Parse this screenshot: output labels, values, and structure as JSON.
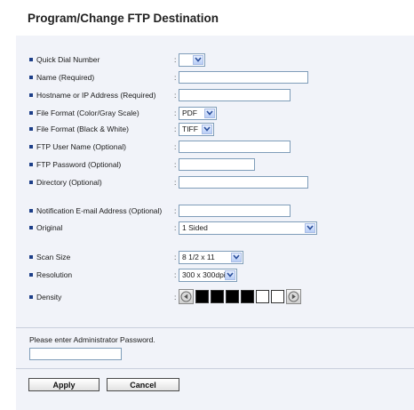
{
  "page": {
    "title": "Program/Change FTP Destination"
  },
  "form": {
    "quick_dial": {
      "label": "Quick Dial Number",
      "value": ""
    },
    "name": {
      "label": "Name (Required)",
      "value": ""
    },
    "hostname": {
      "label": "Hostname or IP Address (Required)",
      "value": ""
    },
    "format_color": {
      "label": "File Format (Color/Gray Scale)",
      "value": "PDF"
    },
    "format_bw": {
      "label": "File Format (Black & White)",
      "value": "TIFF"
    },
    "ftp_user": {
      "label": "FTP User Name (Optional)",
      "value": ""
    },
    "ftp_password": {
      "label": "FTP Password (Optional)",
      "value": ""
    },
    "directory": {
      "label": "Directory (Optional)",
      "value": ""
    },
    "notification_email": {
      "label": "Notification E-mail Address (Optional)",
      "value": ""
    },
    "original": {
      "label": "Original",
      "value": "1 Sided"
    },
    "scan_size": {
      "label": "Scan Size",
      "value": "8 1/2 x 11"
    },
    "resolution": {
      "label": "Resolution",
      "value": "300 x 300dpi"
    },
    "density": {
      "label": "Density",
      "level": 4,
      "max": 7
    },
    "colon": ":"
  },
  "admin": {
    "prompt": "Please enter Administrator Password.",
    "value": ""
  },
  "buttons": {
    "apply": "Apply",
    "cancel": "Cancel"
  },
  "colors": {
    "accent": "#1c3e88",
    "background": "#f1f3f9"
  }
}
